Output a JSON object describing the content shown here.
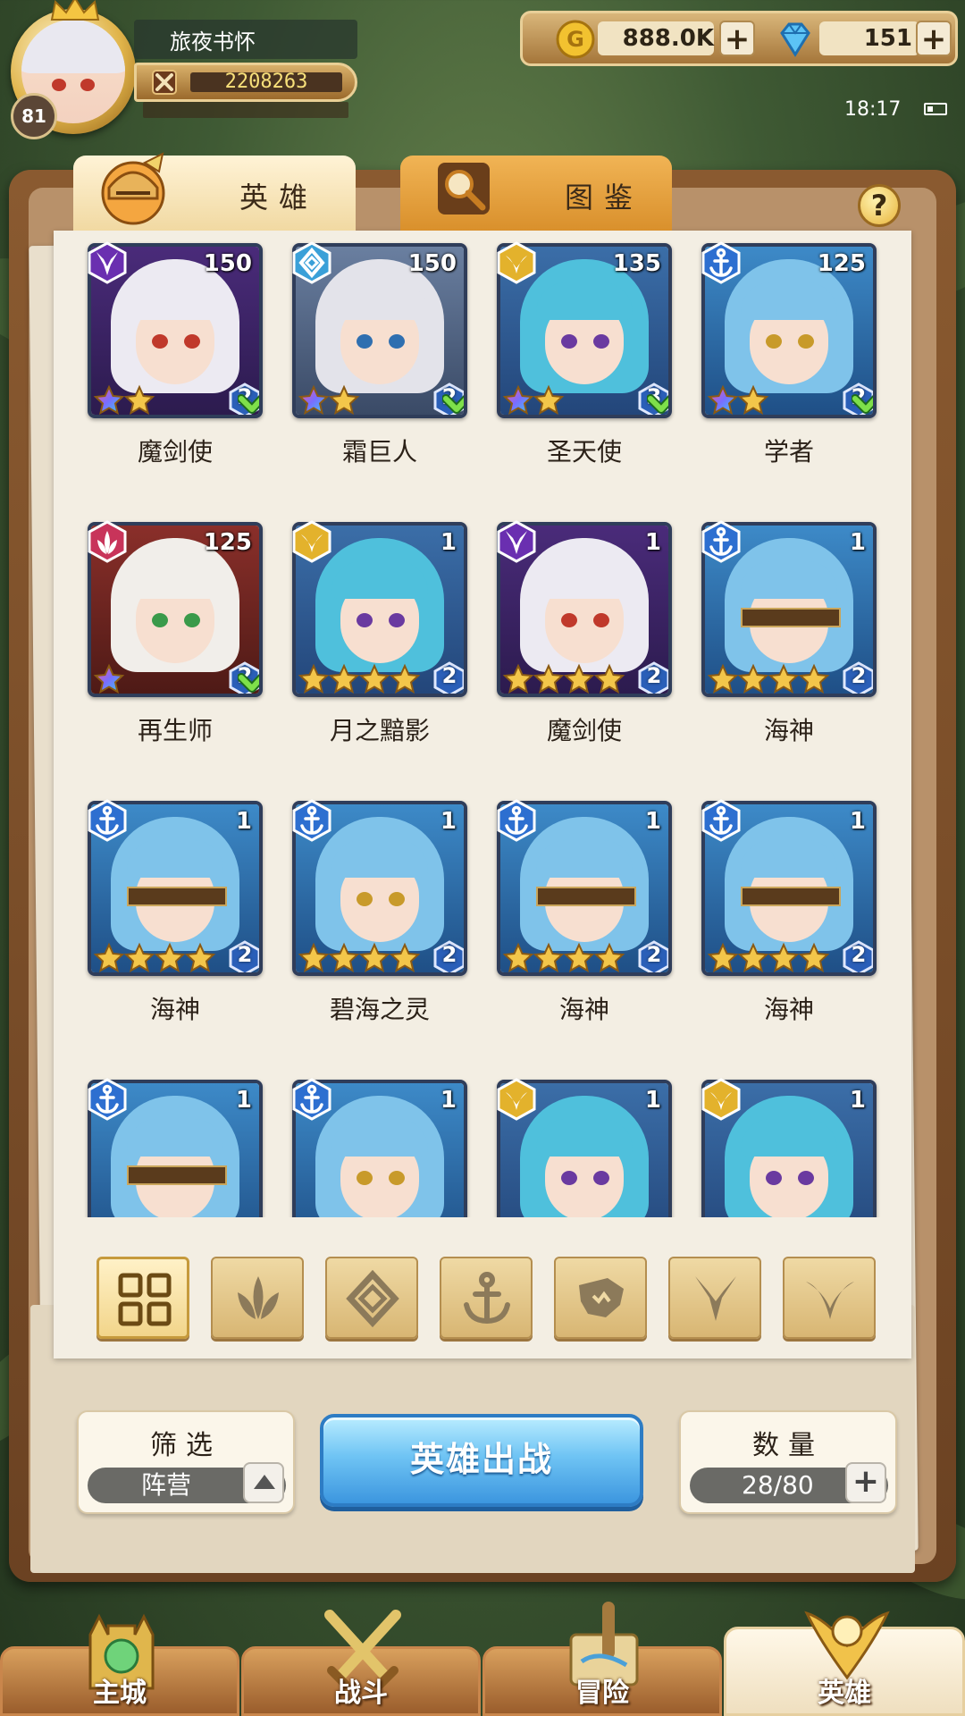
{
  "player": {
    "name": "旅夜书怀",
    "level": "81",
    "power": "2208263"
  },
  "currency": {
    "gold": "888.0K",
    "gems": "151"
  },
  "status": {
    "time": "18:17"
  },
  "tabs": {
    "heroes": "英雄",
    "codex": "图鉴"
  },
  "help_label": "?",
  "heroes": [
    {
      "name": "魔剑使",
      "level": "150",
      "faction": "demon",
      "stars": 2,
      "rank": "2",
      "checked": true
    },
    {
      "name": "霜巨人",
      "level": "150",
      "faction": "diamond",
      "stars": 2,
      "rank": "2",
      "checked": true
    },
    {
      "name": "圣天使",
      "level": "135",
      "faction": "holy",
      "stars": 2,
      "rank": "3",
      "checked": true
    },
    {
      "name": "学者",
      "level": "125",
      "faction": "anchor",
      "stars": 2,
      "rank": "2",
      "checked": true
    },
    {
      "name": "再生师",
      "level": "125",
      "faction": "nature",
      "stars": 1,
      "rank": "2",
      "checked": true
    },
    {
      "name": "月之黯影",
      "level": "1",
      "faction": "holy",
      "stars": 4,
      "rank": "2",
      "checked": false
    },
    {
      "name": "魔剑使",
      "level": "1",
      "faction": "demon",
      "stars": 4,
      "rank": "2",
      "checked": false
    },
    {
      "name": "海神",
      "level": "1",
      "faction": "anchor",
      "stars": 4,
      "rank": "2",
      "checked": false
    },
    {
      "name": "海神",
      "level": "1",
      "faction": "anchor",
      "stars": 4,
      "rank": "2",
      "checked": false
    },
    {
      "name": "碧海之灵",
      "level": "1",
      "faction": "anchor",
      "stars": 4,
      "rank": "2",
      "checked": false
    },
    {
      "name": "海神",
      "level": "1",
      "faction": "anchor",
      "stars": 4,
      "rank": "2",
      "checked": false
    },
    {
      "name": "海神",
      "level": "1",
      "faction": "anchor",
      "stars": 4,
      "rank": "2",
      "checked": false
    },
    {
      "name": "",
      "level": "1",
      "faction": "anchor",
      "stars": 0,
      "rank": "",
      "checked": false
    },
    {
      "name": "",
      "level": "1",
      "faction": "anchor",
      "stars": 0,
      "rank": "",
      "checked": false
    },
    {
      "name": "",
      "level": "1",
      "faction": "holy",
      "stars": 0,
      "rank": "",
      "checked": false
    },
    {
      "name": "",
      "level": "1",
      "faction": "holy",
      "stars": 0,
      "rank": "",
      "checked": false
    }
  ],
  "filters": [
    "all",
    "nature",
    "diamond",
    "anchor",
    "beast",
    "demon",
    "holy"
  ],
  "filter_box": {
    "label": "筛选",
    "value": "阵营"
  },
  "deploy_label": "英雄出战",
  "count_box": {
    "label": "数量",
    "value": "28/80"
  },
  "nav": [
    {
      "label": "主城",
      "icon": "castle-icon"
    },
    {
      "label": "战斗",
      "icon": "swords-icon"
    },
    {
      "label": "冒险",
      "icon": "map-icon"
    },
    {
      "label": "英雄",
      "icon": "hero-crest-icon",
      "active": true
    }
  ],
  "colors": {
    "demon": "#6a2fb0",
    "diamond": "#3aa0d8",
    "holy": "#e3b22c",
    "anchor": "#2d6fd0",
    "nature": "#c8345a",
    "accent_blue": "#3c96df"
  }
}
